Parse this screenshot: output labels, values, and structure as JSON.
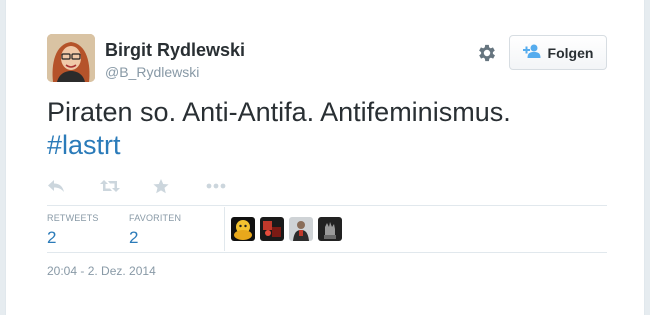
{
  "author": {
    "fullname": "Birgit Rydlewski",
    "screenname": "@B_Rydlewski"
  },
  "header": {
    "gear_icon": "gear-icon",
    "follow_label": "Folgen",
    "follow_icon": "add-user-icon"
  },
  "tweet": {
    "text": "Piraten so. Anti-Antifa. Antifeminismus.",
    "hashtag": "#lastrt"
  },
  "actions": [
    "reply-icon",
    "retweet-icon",
    "favorite-icon",
    "more-icon"
  ],
  "stats": {
    "retweets_label": "RETWEETS",
    "retweets_value": "2",
    "favorites_label": "FAVORITEN",
    "favorites_value": "2"
  },
  "favoriters": [
    "favoriter-avatar-1",
    "favoriter-avatar-2",
    "favoriter-avatar-3",
    "favoriter-avatar-4"
  ],
  "timestamp": "20:04 - 2. Dez. 2014",
  "colors": {
    "accent": "#2b7bb9",
    "text": "#292f33",
    "muted": "#8899a6",
    "icon": "#ccd6dd"
  }
}
